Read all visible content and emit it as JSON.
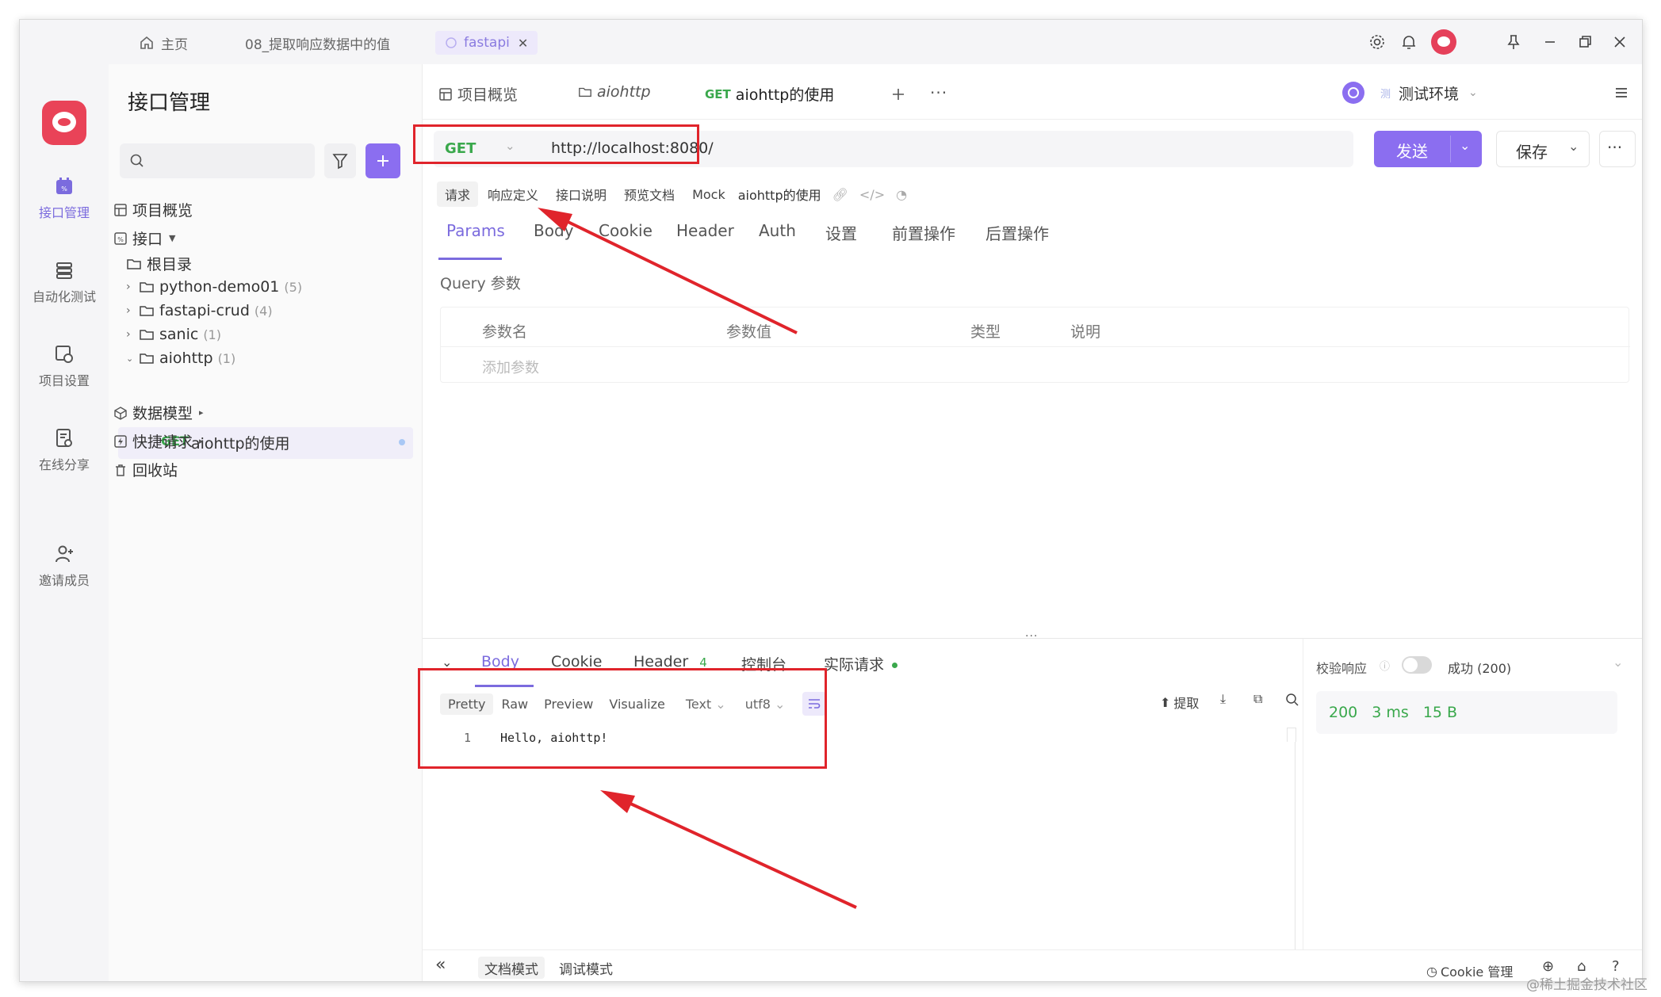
{
  "titlebar": {
    "tabs": [
      {
        "label": "主页"
      },
      {
        "label": "08_提取响应数据中的值"
      },
      {
        "label": "fastapi"
      }
    ]
  },
  "rail": {
    "items": [
      {
        "label": "接口管理"
      },
      {
        "label": "自动化测试"
      },
      {
        "label": "项目设置"
      },
      {
        "label": "在线分享"
      },
      {
        "label": "邀请成员"
      }
    ]
  },
  "tree": {
    "title": "接口管理",
    "overview": "项目概览",
    "api_root": "接口",
    "root_dir": "根目录",
    "folders": [
      {
        "name": "python-demo01",
        "count": "(5)"
      },
      {
        "name": "fastapi-crud",
        "count": "(4)"
      },
      {
        "name": "sanic",
        "count": "(1)"
      },
      {
        "name": "aiohttp",
        "count": "(1)"
      }
    ],
    "selected_item": {
      "method": "GET",
      "name": "aiohttp的使用"
    },
    "data_model": "数据模型",
    "quick_request": "快捷请求",
    "recycle": "回收站"
  },
  "main": {
    "tabs": [
      {
        "label": "项目概览"
      },
      {
        "label": "aiohttp"
      },
      {
        "method": "GET",
        "label": "aiohttp的使用"
      }
    ],
    "env": "测试环境",
    "method": "GET",
    "url": "http://localhost:8080/",
    "send": "发送",
    "save": "保存",
    "subtabs": [
      "请求",
      "响应定义",
      "接口说明",
      "预览文档",
      "Mock"
    ],
    "api_name": "aiohttp的使用",
    "param_tabs": [
      "Params",
      "Body",
      "Cookie",
      "Header",
      "Auth",
      "设置",
      "前置操作",
      "后置操作"
    ],
    "query_label": "Query 参数",
    "query_headers": [
      "参数名",
      "参数值",
      "类型",
      "说明"
    ],
    "add_param": "添加参数"
  },
  "response": {
    "tabs": [
      {
        "label": "Body"
      },
      {
        "label": "Cookie"
      },
      {
        "label": "Header",
        "badge": "4"
      },
      {
        "label": "控制台"
      },
      {
        "label": "实际请求"
      }
    ],
    "formats": [
      "Pretty",
      "Raw",
      "Preview",
      "Visualize",
      "Text",
      "utf8"
    ],
    "extract": "提取",
    "line_no": "1",
    "body_text": "Hello, aiohttp!",
    "validate_label": "校验响应",
    "result": "成功 (200)",
    "status": "200",
    "time": "3 ms",
    "size": "15 B"
  },
  "footer": {
    "doc_mode": "文档模式",
    "debug_mode": "调试模式",
    "cookie_mgmt": "Cookie 管理"
  },
  "watermark": "@稀土掘金技术社区",
  "colors": {
    "accent": "#8b6ef0",
    "get": "#3aa84c",
    "annotation_red": "#e0242b"
  }
}
